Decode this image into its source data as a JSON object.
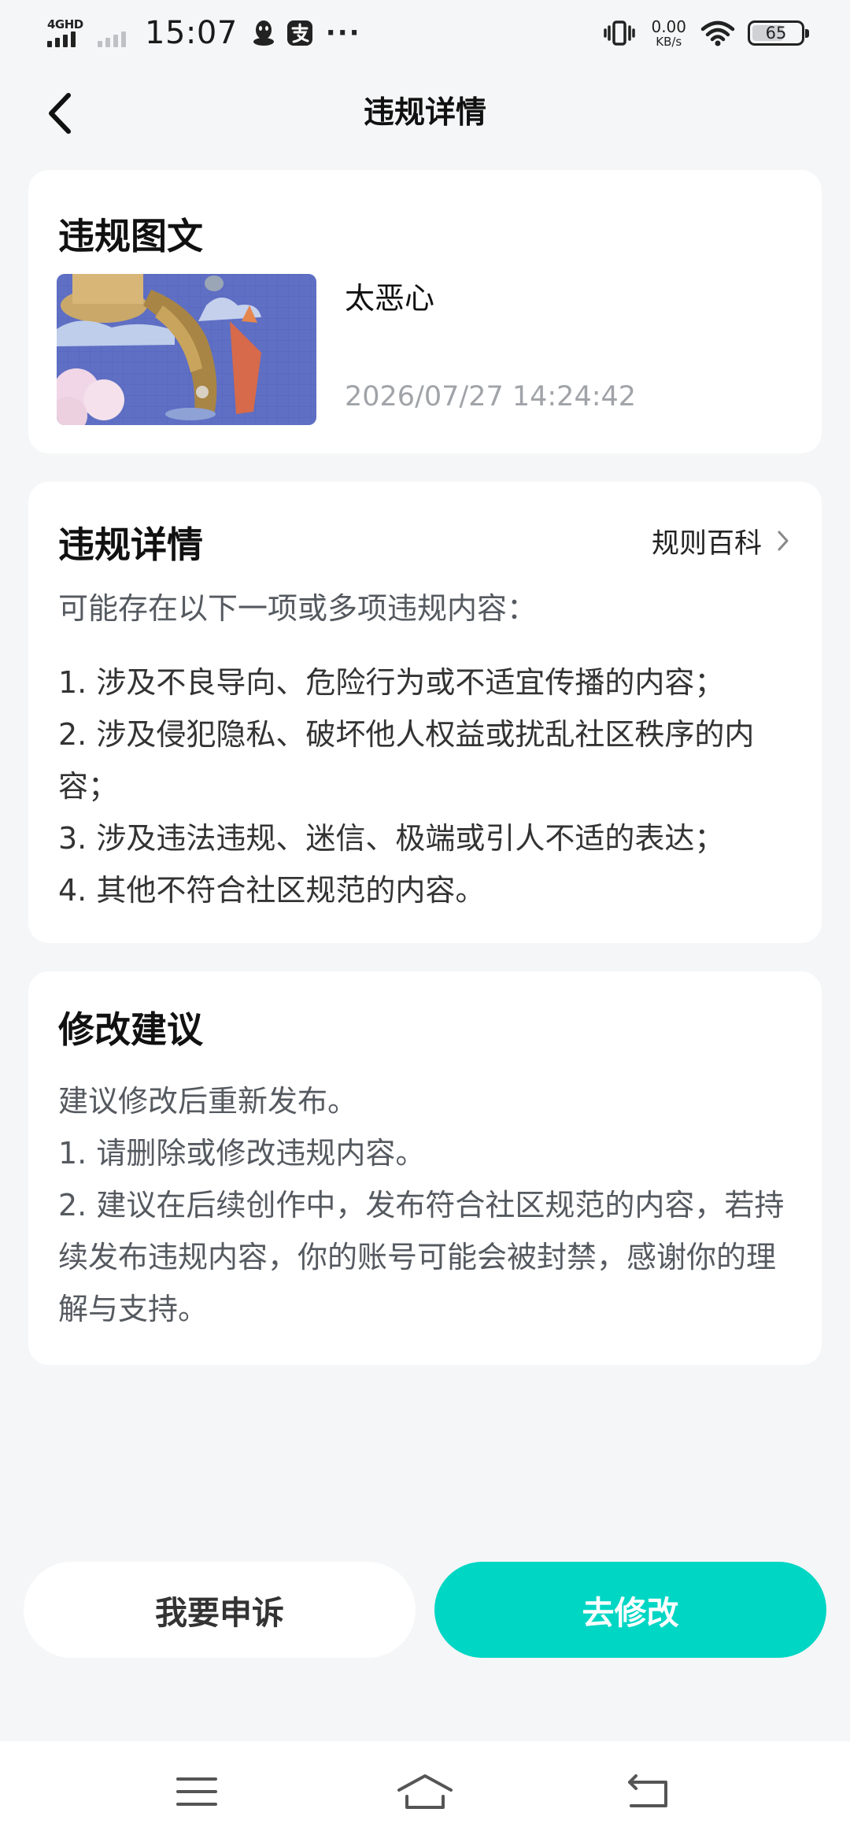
{
  "status_bar": {
    "network_type": "4GHD",
    "time": "15:07",
    "speed_value": "0.00",
    "speed_unit": "KB/s",
    "battery": "65",
    "notification_icons": [
      "qq-icon",
      "alipay-icon",
      "more-dots-icon"
    ],
    "more": "···"
  },
  "header": {
    "title": "违规详情"
  },
  "post_card": {
    "title": "违规图文",
    "post_text": "太恶心",
    "post_time": "2026/07/27 14:24:42"
  },
  "detail_card": {
    "title": "违规详情",
    "rules_link": "规则百科",
    "intro": "可能存在以下一项或多项违规内容：",
    "items": [
      "1. 涉及不良导向、危险行为或不适宜传播的内容；",
      "2. 涉及侵犯隐私、破坏他人权益或扰乱社区秩序的内容；",
      "3. 涉及违法违规、迷信、极端或引人不适的表达；",
      "4. 其他不符合社区规范的内容。"
    ]
  },
  "suggest_card": {
    "title": "修改建议",
    "lines": [
      "建议修改后重新发布。",
      "1. 请删除或修改违规内容。",
      "2. 建议在后续创作中，发布符合社区规范的内容，若持续发布违规内容，你的账号可能会被封禁，感谢你的理解与支持。"
    ]
  },
  "actions": {
    "appeal": "我要申诉",
    "edit": "去修改"
  },
  "colors": {
    "accent": "#00d6c4",
    "background": "#f5f6f7",
    "card": "#ffffff",
    "muted_text": "#a0a3a8"
  }
}
